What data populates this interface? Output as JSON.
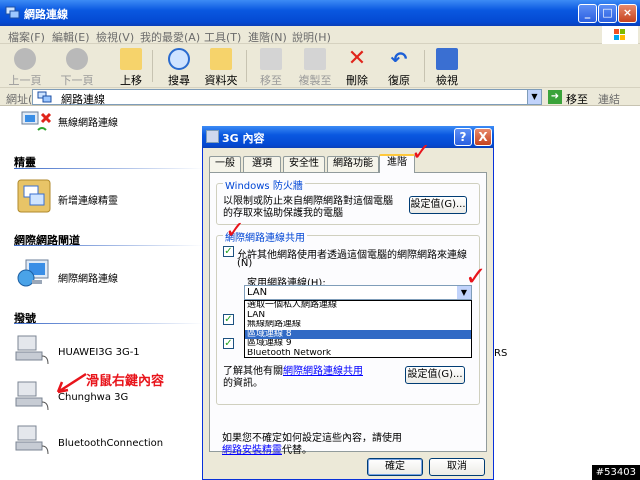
{
  "window": {
    "title": "網路連線"
  },
  "menu": [
    "檔案(F)",
    "編輯(E)",
    "檢視(V)",
    "我的最愛(A)",
    "工具(T)",
    "進階(N)",
    "說明(H)"
  ],
  "toolbar": {
    "back": "上一頁",
    "forward": "下一頁",
    "up": "上移",
    "search": "搜尋",
    "folders": "資料夾",
    "move": "移至",
    "copy": "複製至",
    "delete": "刪除",
    "undo": "復原",
    "views": "檢視"
  },
  "address": {
    "label": "網址(D)",
    "value": "網路連線",
    "go": "移至",
    "links": "連結"
  },
  "explorer": {
    "wireless_item": "無線網路連線",
    "wizard_group": "精靈",
    "wizard_item": "新增連線精靈",
    "internet_group": "網際網路閘道",
    "internet_item": "網際網路連線",
    "dialup_group": "撥號",
    "dialup_items": [
      "HUAWEI3G 3G-1",
      "Chunghwa 3G",
      "BluetoothConnection"
    ],
    "right_edge_fragment": "RS"
  },
  "annotation": "滑鼠右鍵內容",
  "dialog": {
    "title": "3G 內容",
    "tabs": [
      "一般",
      "選項",
      "安全性",
      "網路功能",
      "進階"
    ],
    "active_tab": "進階",
    "firewall": {
      "legend": "Windows 防火牆",
      "desc_line1": "以限制或防止來自網際網路對這個電腦",
      "desc_line2": "的存取來協助保護我的電腦",
      "settings_button": "設定值(G)..."
    },
    "ics": {
      "legend": "網際網路連線共用",
      "allow_line1": "允許其他網路使用者透過這個電腦的網際網路來連線",
      "allow_line2": "(N)",
      "home_label": "家用網路連線(H):",
      "combo_value": "LAN",
      "options": [
        "選取一個私人網路連線",
        "LAN",
        "無線網路連線",
        "區域連線 8",
        "區域連線 9",
        "Bluetooth Network"
      ],
      "selected_index": 3,
      "learn_more_prefix": "了解其他有關",
      "learn_more_link": "網際網路連線共用",
      "learn_more_suffix": "的資訊。",
      "settings_button": "設定值(G)..."
    },
    "help_line1": "如果您不確定如何設定這些內容，請使用",
    "help_link": "網路安裝精靈",
    "help_suffix": "代替。",
    "ok": "確定",
    "cancel": "取消",
    "help_button": "?",
    "close_button": "X"
  },
  "stamp": "#53403",
  "colors": {
    "title_blue": "#0a58e0",
    "mark_red": "#e8141b",
    "selection": "#316ac5"
  }
}
